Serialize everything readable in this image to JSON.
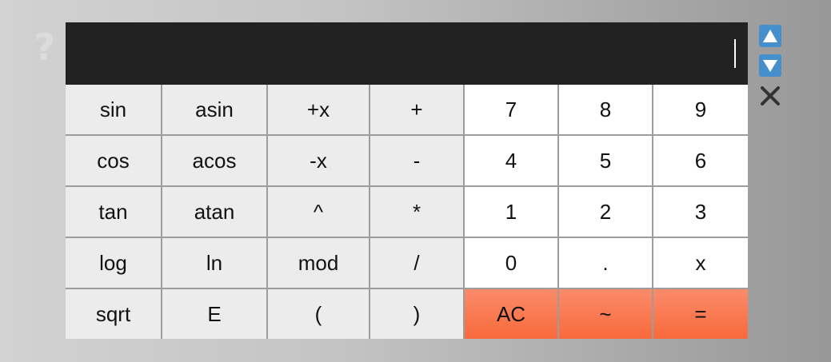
{
  "help": {
    "glyph": "?",
    "icon": "question-mark-icon"
  },
  "display": {
    "value": ""
  },
  "keys": [
    {
      "label": "sin",
      "kind": "fn",
      "name": "key-sin"
    },
    {
      "label": "asin",
      "kind": "fn",
      "name": "key-asin"
    },
    {
      "label": "+x",
      "kind": "fn",
      "name": "key-plus-x"
    },
    {
      "label": "+",
      "kind": "fn",
      "name": "key-add"
    },
    {
      "label": "7",
      "kind": "num",
      "name": "key-7"
    },
    {
      "label": "8",
      "kind": "num",
      "name": "key-8"
    },
    {
      "label": "9",
      "kind": "num",
      "name": "key-9"
    },
    {
      "label": "cos",
      "kind": "fn",
      "name": "key-cos"
    },
    {
      "label": "acos",
      "kind": "fn",
      "name": "key-acos"
    },
    {
      "label": "-x",
      "kind": "fn",
      "name": "key-minus-x"
    },
    {
      "label": "-",
      "kind": "fn",
      "name": "key-subtract"
    },
    {
      "label": "4",
      "kind": "num",
      "name": "key-4"
    },
    {
      "label": "5",
      "kind": "num",
      "name": "key-5"
    },
    {
      "label": "6",
      "kind": "num",
      "name": "key-6"
    },
    {
      "label": "tan",
      "kind": "fn",
      "name": "key-tan"
    },
    {
      "label": "atan",
      "kind": "fn",
      "name": "key-atan"
    },
    {
      "label": "^",
      "kind": "fn",
      "name": "key-power"
    },
    {
      "label": "*",
      "kind": "fn",
      "name": "key-multiply"
    },
    {
      "label": "1",
      "kind": "num",
      "name": "key-1"
    },
    {
      "label": "2",
      "kind": "num",
      "name": "key-2"
    },
    {
      "label": "3",
      "kind": "num",
      "name": "key-3"
    },
    {
      "label": "log",
      "kind": "fn",
      "name": "key-log"
    },
    {
      "label": "ln",
      "kind": "fn",
      "name": "key-ln"
    },
    {
      "label": "mod",
      "kind": "fn",
      "name": "key-mod"
    },
    {
      "label": "/",
      "kind": "fn",
      "name": "key-divide"
    },
    {
      "label": "0",
      "kind": "num",
      "name": "key-0"
    },
    {
      "label": ".",
      "kind": "num",
      "name": "key-decimal"
    },
    {
      "label": "x",
      "kind": "num",
      "name": "key-variable-x"
    },
    {
      "label": "sqrt",
      "kind": "fn",
      "name": "key-sqrt"
    },
    {
      "label": "E",
      "kind": "fn",
      "name": "key-e"
    },
    {
      "label": "(",
      "kind": "fn",
      "name": "key-open-paren"
    },
    {
      "label": ")",
      "kind": "fn",
      "name": "key-close-paren"
    },
    {
      "label": "AC",
      "kind": "action",
      "name": "key-all-clear"
    },
    {
      "label": "~",
      "kind": "action",
      "name": "key-tilde"
    },
    {
      "label": "=",
      "kind": "action",
      "name": "key-equals"
    }
  ],
  "side_controls": {
    "up_icon": "triangle-up-icon",
    "down_icon": "triangle-down-icon",
    "close_icon": "close-x-icon"
  },
  "colors": {
    "display_bg": "#222222",
    "function_key_bg": "#ececec",
    "number_key_bg": "#ffffff",
    "action_key_bg": "#f76a3c",
    "arrow_button_bg": "#4590cc",
    "close_icon": "#333333",
    "help_icon": "#dcdcdc"
  }
}
